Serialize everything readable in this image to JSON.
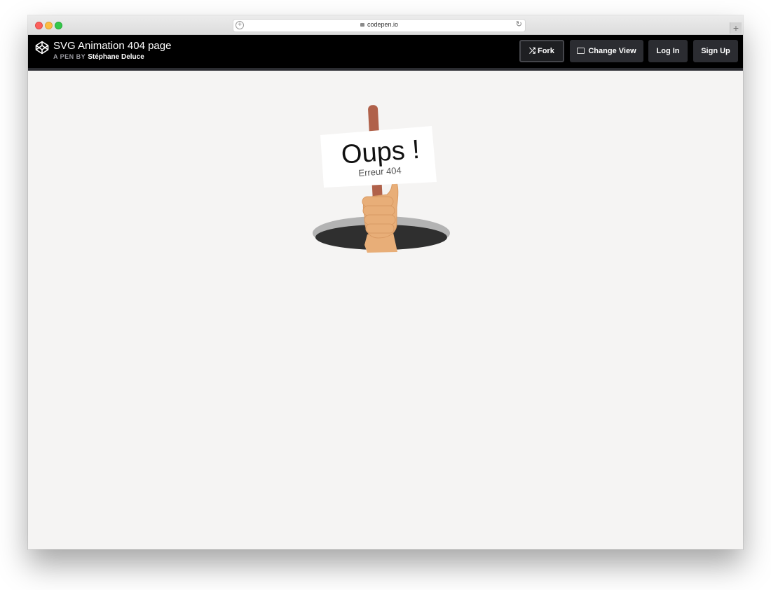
{
  "browser": {
    "url": "codepen.io"
  },
  "header": {
    "title": "SVG Animation 404 page",
    "by_label": "A PEN BY",
    "author": "Stéphane Deluce",
    "buttons": {
      "fork": "Fork",
      "change_view": "Change View",
      "login": "Log In",
      "signup": "Sign Up"
    }
  },
  "sign": {
    "title": "Oups !",
    "subtitle": "Erreur 404"
  },
  "colors": {
    "page_background": "#f5f4f3",
    "header_background": "#000000",
    "button_background": "#2b2c31",
    "stick": "#b0614a",
    "hand": "#e8ae78",
    "hole": "#2f2f2f",
    "hole_rim": "#b3b3b3"
  },
  "icons": {
    "logo": "codepen-logo-icon",
    "fork": "fork-icon",
    "change_view": "change-view-icon",
    "lock": "lock-icon",
    "reload": "reload-icon",
    "new_tab": "plus-icon"
  }
}
